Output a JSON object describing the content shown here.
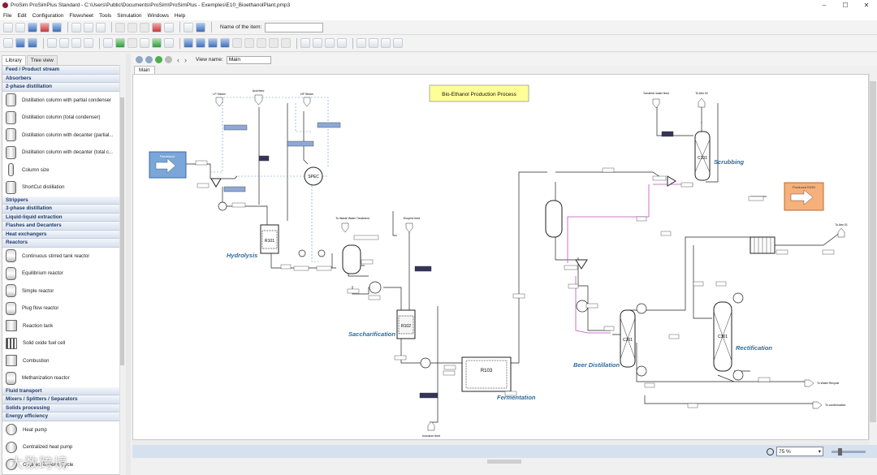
{
  "window": {
    "title": "ProSim ProSimPlus Standard - C:\\Users\\Public\\Documents\\ProSim\\ProSimPlus - Exemples\\E10_BioethanolPlant.pmp3",
    "minimize": "–",
    "maximize": "☐",
    "close": "✕"
  },
  "menu": [
    "File",
    "Edit",
    "Configuration",
    "Flowsheet",
    "Tools",
    "Simulation",
    "Windows",
    "Help"
  ],
  "toolbar": {
    "name_label": "Name of the item:",
    "name_value": ""
  },
  "left_tabs": [
    "Library",
    "Tree view"
  ],
  "library": [
    {
      "category": "Feed / Product stream",
      "items": []
    },
    {
      "category": "Absorbers",
      "items": []
    },
    {
      "category": "2-phase distillation",
      "items": [
        "Distillation column with partial condenser",
        "Distillation column (total condenser)",
        "Distillation column with decanter (partial...",
        "Distillation column with decanter (total c...",
        "Column size",
        "ShortCut distillation"
      ]
    },
    {
      "category": "Strippers",
      "items": []
    },
    {
      "category": "3-phase distillation",
      "items": []
    },
    {
      "category": "Liquid-liquid extraction",
      "items": []
    },
    {
      "category": "Flashes and Decanters",
      "items": []
    },
    {
      "category": "Heat exchangers",
      "items": []
    },
    {
      "category": "Reactors",
      "items": [
        "Continuous stirred tank reactor",
        "Equilibrium reactor",
        "Simple reactor",
        "Plug flow reactor",
        "Reaction tank",
        "Solid oxide fuel cell",
        "Combustion",
        "Methanization reactor"
      ]
    },
    {
      "category": "Fluid transport",
      "items": []
    },
    {
      "category": "Mixers / Splitters / Separators",
      "items": []
    },
    {
      "category": "Solids processing",
      "items": []
    },
    {
      "category": "Energy efficiency",
      "items": [
        "Heat pump",
        "Centralized heat pump",
        "Organic Rankine Cycle"
      ]
    }
  ],
  "viewbar": {
    "label": "View name:",
    "value": "Main"
  },
  "main_tab": "Main",
  "flowsheet": {
    "title": "Bio-Ethanol Production Process",
    "sections": [
      "Hydrolysis",
      "Saccharification",
      "Fermentation",
      "Scrubbing",
      "Beer Distillation",
      "Rectification"
    ],
    "feeds": {
      "feed": "Feedstock",
      "acid": "Acid feed",
      "lp": "LP Steam",
      "hp": "HP Steam",
      "enzyme": "Enzyme feed",
      "inoculum": "Inoculum feed",
      "scrubber": "Scrubber water feed"
    },
    "products": {
      "ethanol": "Produced EtOH",
      "air1": "To Atm 01",
      "air2": "To Atm 02",
      "water": "To Waste Water Treatment",
      "wrecycle": "To Water Recycle",
      "cond": "To condensation"
    },
    "blocks": {
      "reactor1": "R101",
      "reactor2": "R102",
      "reactor3": "R103",
      "spec": "SPEC",
      "col1": "C101",
      "col2": "C201",
      "col3": "C301"
    }
  },
  "status": {
    "zoom": "75 %"
  },
  "watermark": "大数跨境"
}
